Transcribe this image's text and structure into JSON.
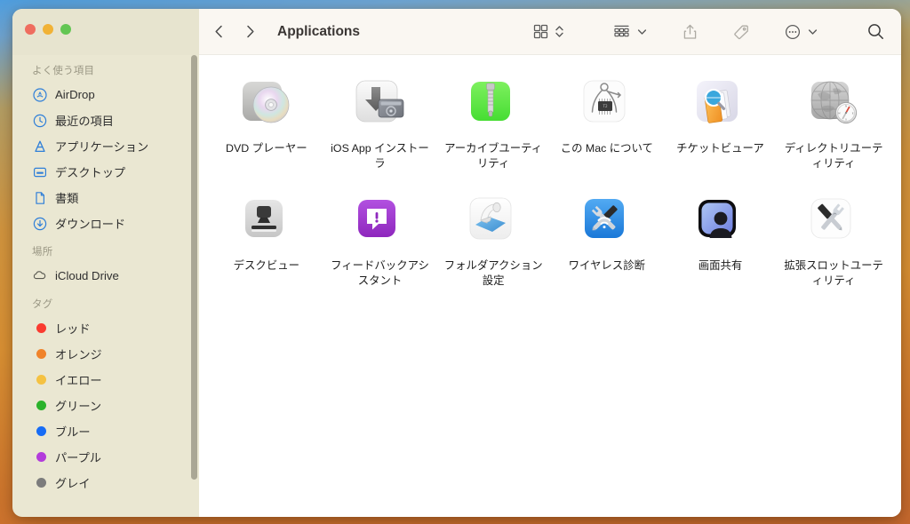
{
  "window": {
    "title": "Applications",
    "traffic_lights": [
      {
        "name": "close",
        "color": "#ef6d5f"
      },
      {
        "name": "minimize",
        "color": "#f1b236"
      },
      {
        "name": "zoom",
        "color": "#63c653"
      }
    ]
  },
  "toolbar": {
    "back_icon": "chevron-left-icon",
    "forward_icon": "chevron-right-icon",
    "title": "Applications",
    "view_icon": "grid-view-icon",
    "view_stepper_icon": "up-down-chevron-icon",
    "group_icon": "group-by-icon",
    "group_chevron_icon": "chevron-down-icon",
    "share_icon": "share-icon",
    "tag_icon": "tag-icon",
    "more_icon": "ellipsis-circle-icon",
    "more_chevron_icon": "chevron-down-icon",
    "search_icon": "search-icon"
  },
  "sidebar": {
    "sections": [
      {
        "header": "よく使う項目",
        "items": [
          {
            "label": "AirDrop",
            "icon": "airdrop-icon"
          },
          {
            "label": "最近の項目",
            "icon": "clock-icon"
          },
          {
            "label": "アプリケーション",
            "icon": "applications-icon"
          },
          {
            "label": "デスクトップ",
            "icon": "desktop-icon"
          },
          {
            "label": "書類",
            "icon": "document-icon"
          },
          {
            "label": "ダウンロード",
            "icon": "download-icon"
          }
        ]
      },
      {
        "header": "場所",
        "items": [
          {
            "label": "iCloud Drive",
            "icon": "cloud-icon"
          }
        ]
      },
      {
        "header": "タグ",
        "items": [
          {
            "label": "レッド",
            "icon": "tag-dot",
            "color": "#fa3b30"
          },
          {
            "label": "オレンジ",
            "icon": "tag-dot",
            "color": "#f0832a"
          },
          {
            "label": "イエロー",
            "icon": "tag-dot",
            "color": "#f5c242"
          },
          {
            "label": "グリーン",
            "icon": "tag-dot",
            "color": "#2bb22b"
          },
          {
            "label": "ブルー",
            "icon": "tag-dot",
            "color": "#176cf5"
          },
          {
            "label": "パープル",
            "icon": "tag-dot",
            "color": "#b33cdb"
          },
          {
            "label": "グレイ",
            "icon": "tag-dot",
            "color": "#7c7c7c"
          }
        ]
      }
    ]
  },
  "files": [
    {
      "label": "DVD プレーヤー",
      "icon": "dvd-player-icon",
      "selected": false
    },
    {
      "label": "iOS App インストーラ",
      "icon": "ios-app-installer-icon",
      "selected": false
    },
    {
      "label": "アーカイブユーティリティ",
      "icon": "archive-utility-icon",
      "selected": false
    },
    {
      "label": "この Mac について",
      "icon": "about-this-mac-icon",
      "selected": false
    },
    {
      "label": "チケットビューア",
      "icon": "ticket-viewer-icon",
      "selected": false
    },
    {
      "label": "ディレクトリユーティリティ",
      "icon": "directory-utility-icon",
      "selected": true
    },
    {
      "label": "デスクビュー",
      "icon": "desk-view-icon",
      "selected": false
    },
    {
      "label": "フィードバックアシスタント",
      "icon": "feedback-assistant-icon",
      "selected": false
    },
    {
      "label": "フォルダアクション設定",
      "icon": "folder-actions-setup-icon",
      "selected": false
    },
    {
      "label": "ワイヤレス診断",
      "icon": "wireless-diagnostics-icon",
      "selected": false
    },
    {
      "label": "画面共有",
      "icon": "screen-sharing-icon",
      "selected": false
    },
    {
      "label": "拡張スロットユーティリティ",
      "icon": "expansion-slot-utility-icon",
      "selected": false
    }
  ],
  "annotation": {
    "name": "directory-utility-highlight",
    "color": "#e8401f",
    "target_label": "ディレクトリユーティリティ"
  }
}
